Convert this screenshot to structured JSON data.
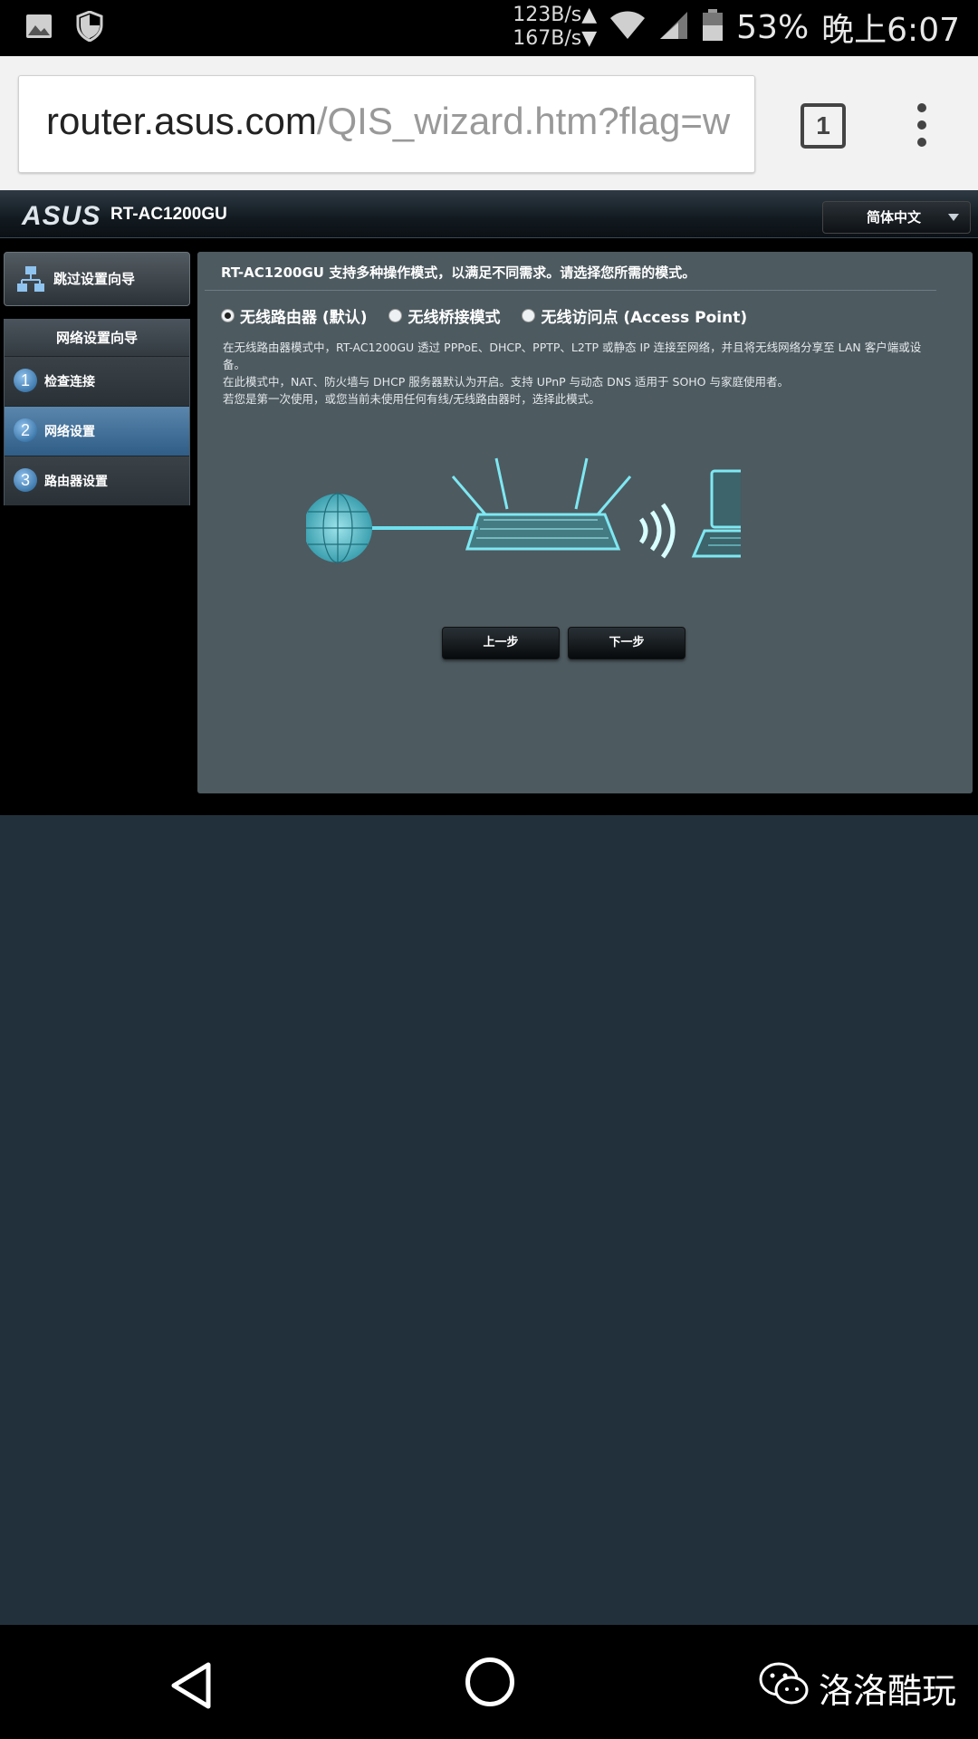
{
  "status_bar": {
    "upload_speed": "123B/s",
    "download_speed": "167B/s",
    "battery": "53%",
    "time": "晚上6:07"
  },
  "browser": {
    "url_host": "router.asus.com",
    "url_path": "/QIS_wizard.htm?flag=w",
    "tab_count": "1"
  },
  "router": {
    "brand": "ASUS",
    "model": "RT-AC1200GU",
    "language": "简体中文",
    "skip_wizard_label": "跳过设置向导",
    "wizard_title": "网络设置向导",
    "steps": [
      {
        "num": "1",
        "label": "检查连接"
      },
      {
        "num": "2",
        "label": "网络设置"
      },
      {
        "num": "3",
        "label": "路由器设置"
      }
    ],
    "active_step": 2,
    "content": {
      "title": "RT-AC1200GU 支持多种操作模式，以满足不同需求。请选择您所需的模式。",
      "modes": [
        {
          "label": "无线路由器 (默认)",
          "selected": true
        },
        {
          "label": "无线桥接模式",
          "selected": false
        },
        {
          "label": "无线访问点 (Access Point)",
          "selected": false
        }
      ],
      "description": [
        "在无线路由器模式中，RT-AC1200GU 透过 PPPoE、DHCP、PPTP、L2TP 或静态 IP 连接至网络，并且将无线网络分享至 LAN 客户端或设备。",
        "在此模式中，NAT、防火墙与 DHCP 服务器默认为开启。支持 UPnP 与动态 DNS 适用于 SOHO 与家庭使用者。",
        "若您是第一次使用，或您当前未使用任何有线/无线路由器时，选择此模式。"
      ],
      "prev_label": "上一步",
      "next_label": "下一步"
    }
  },
  "watermark": "洛洛酷玩",
  "colors": {
    "page_bg": "#22303c",
    "panel_bg": "#4d5a60",
    "active_step": "#3f6f99",
    "illustration": "#6fe0ee"
  }
}
